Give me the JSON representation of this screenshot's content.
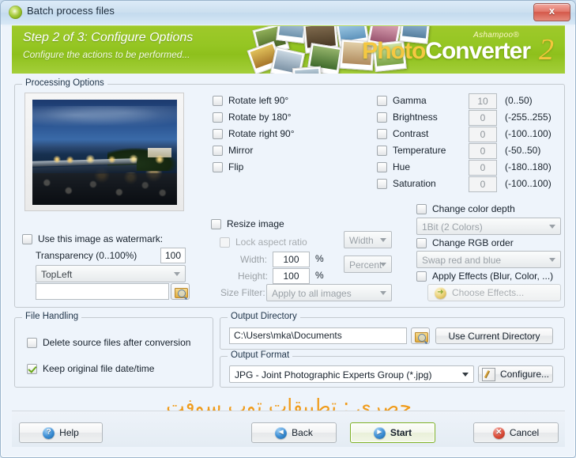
{
  "window": {
    "title": "Batch process files",
    "close_label": "x",
    "app_icon": "app-globe-icon"
  },
  "banner": {
    "step_title": "Step 2 of 3: Configure Options",
    "subtitle": "Configure the actions to be performed...",
    "logo_brand": "Ashampoo®",
    "logo_part1": "Photo",
    "logo_part2": "Converter",
    "logo_version": "2",
    "bg_color": "#95c623"
  },
  "processing": {
    "legend": "Processing Options",
    "transforms": [
      {
        "label": "Rotate left 90°",
        "checked": false
      },
      {
        "label": "Rotate by 180°",
        "checked": false
      },
      {
        "label": "Rotate right 90°",
        "checked": false
      },
      {
        "label": "Mirror",
        "checked": false
      },
      {
        "label": "Flip",
        "checked": false
      }
    ],
    "adjustments": [
      {
        "label": "Gamma",
        "checked": false,
        "value": "10",
        "range": "(0..50)"
      },
      {
        "label": "Brightness",
        "checked": false,
        "value": "0",
        "range": "(-255..255)"
      },
      {
        "label": "Contrast",
        "checked": false,
        "value": "0",
        "range": "(-100..100)"
      },
      {
        "label": "Temperature",
        "checked": false,
        "value": "0",
        "range": "(-50..50)"
      },
      {
        "label": "Hue",
        "checked": false,
        "value": "0",
        "range": "(-180..180)"
      },
      {
        "label": "Saturation",
        "checked": false,
        "value": "0",
        "range": "(-100..100)"
      }
    ],
    "watermark": {
      "use_label": "Use this image as watermark:",
      "use_checked": false,
      "transparency_label": "Transparency (0..100%)",
      "transparency_value": "100",
      "position_value": "TopLeft",
      "path_value": "",
      "browse_icon": "folder-search-icon"
    },
    "resize": {
      "label": "Resize image",
      "checked": false,
      "lock_label": "Lock aspect ratio",
      "lock_checked": false,
      "dimension_mode": "Width",
      "width_label": "Width:",
      "width_value": "100",
      "width_unit": "%",
      "height_label": "Height:",
      "height_value": "100",
      "height_unit": "%",
      "unit_mode": "Percent",
      "size_filter_label": "Size Filter:",
      "size_filter_value": "Apply to all images"
    },
    "color": {
      "depth_label": "Change color depth",
      "depth_checked": false,
      "depth_value": "1Bit (2 Colors)",
      "rgb_label": "Change RGB order",
      "rgb_checked": false,
      "rgb_value": "Swap red and blue",
      "effects_label": "Apply Effects (Blur, Color, ...)",
      "effects_checked": false,
      "effects_button": "Choose Effects..."
    },
    "preview_alt": "night river bridge photo preview"
  },
  "file_handling": {
    "legend": "File Handling",
    "items": [
      {
        "label": "Delete source files after conversion",
        "checked": false
      },
      {
        "label": "Keep original file date/time",
        "checked": true
      }
    ]
  },
  "output_directory": {
    "legend": "Output Directory",
    "path_value": "C:\\Users\\mka\\Documents",
    "browse_icon": "folder-search-icon",
    "use_current_label": "Use Current Directory"
  },
  "output_format": {
    "legend": "Output Format",
    "format_value": "JPG - Joint Photographic Experts Group (*.jpg)",
    "configure_label": "Configure..."
  },
  "watermark_overlay": {
    "text": "حصري : تطبيقات توب سوفت",
    "color": "#ef9b1b"
  },
  "footer": {
    "help": "Help",
    "back": "Back",
    "start": "Start",
    "cancel": "Cancel"
  }
}
